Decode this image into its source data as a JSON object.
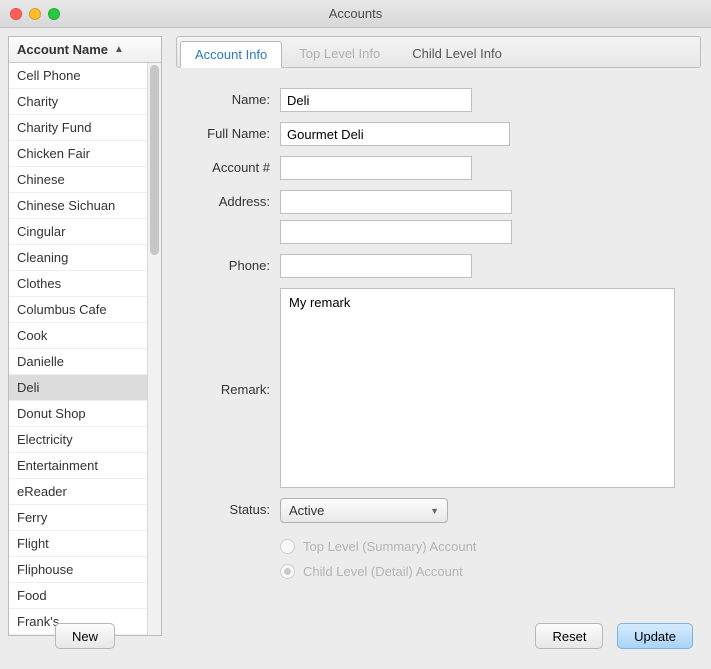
{
  "window": {
    "title": "Accounts"
  },
  "sidebar": {
    "header": "Account Name",
    "items": [
      "Cell Phone",
      "Charity",
      "Charity Fund",
      "Chicken Fair",
      "Chinese",
      "Chinese Sichuan",
      "Cingular",
      "Cleaning",
      "Clothes",
      "Columbus Cafe",
      "Cook",
      "Danielle",
      "Deli",
      "Donut Shop",
      "Electricity",
      "Entertainment",
      "eReader",
      "Ferry",
      "Flight",
      "Fliphouse",
      "Food",
      "Frank's"
    ],
    "selected_index": 12
  },
  "tabs": [
    {
      "label": "Account Info",
      "state": "active"
    },
    {
      "label": "Top Level Info",
      "state": "disabled"
    },
    {
      "label": "Child Level Info",
      "state": "normal"
    }
  ],
  "form": {
    "labels": {
      "name": "Name:",
      "fullname": "Full Name:",
      "account": "Account #",
      "address": "Address:",
      "phone": "Phone:",
      "remark": "Remark:",
      "status": "Status:"
    },
    "values": {
      "name": "Deli",
      "fullname": "Gourmet Deli",
      "account": "",
      "address1": "",
      "address2": "",
      "phone": "",
      "remark": "My remark",
      "status": "Active"
    },
    "radios": {
      "top": "Top Level (Summary) Account",
      "child": "Child Level (Detail) Account",
      "selected": "child"
    }
  },
  "buttons": {
    "new": "New",
    "reset": "Reset",
    "update": "Update"
  }
}
